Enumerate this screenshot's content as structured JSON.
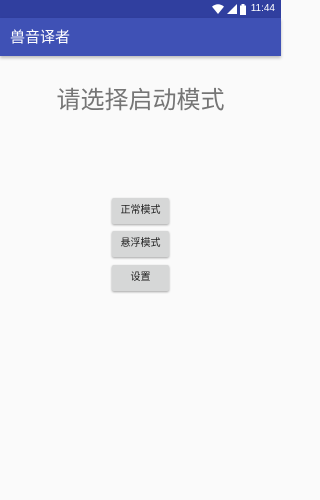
{
  "status_bar": {
    "time": "11:44",
    "icons": [
      "wifi-icon",
      "cellular-signal-icon",
      "battery-icon"
    ],
    "color": "#303f9f"
  },
  "app_bar": {
    "title": "兽音译者",
    "color": "#3f51b5"
  },
  "main": {
    "prompt": "请选择启动模式",
    "buttons": {
      "normal_mode": "正常模式",
      "floating_mode": "悬浮模式",
      "settings": "设置"
    }
  }
}
